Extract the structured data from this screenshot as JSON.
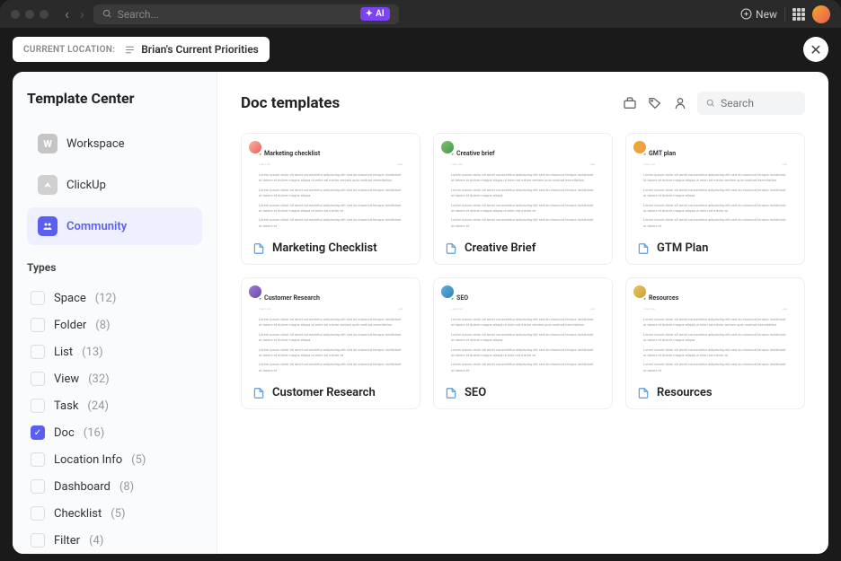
{
  "topbar": {
    "search_placeholder": "Search...",
    "ai_label": "AI",
    "new_label": "New"
  },
  "location": {
    "label": "CURRENT LOCATION:",
    "value": "Brian's Current Priorities"
  },
  "sidebar": {
    "title": "Template Center",
    "sources": [
      {
        "label": "Workspace",
        "icon": "W"
      },
      {
        "label": "ClickUp",
        "icon": ""
      },
      {
        "label": "Community",
        "icon": ""
      }
    ],
    "types_header": "Types",
    "types": [
      {
        "label": "Space",
        "count": "(12)",
        "checked": false
      },
      {
        "label": "Folder",
        "count": "(8)",
        "checked": false
      },
      {
        "label": "List",
        "count": "(13)",
        "checked": false
      },
      {
        "label": "View",
        "count": "(32)",
        "checked": false
      },
      {
        "label": "Task",
        "count": "(24)",
        "checked": false
      },
      {
        "label": "Doc",
        "count": "(16)",
        "checked": true
      },
      {
        "label": "Location Info",
        "count": "(5)",
        "checked": false
      },
      {
        "label": "Dashboard",
        "count": "(8)",
        "checked": false
      },
      {
        "label": "Checklist",
        "count": "(5)",
        "checked": false
      },
      {
        "label": "Filter",
        "count": "(4)",
        "checked": false
      }
    ]
  },
  "main": {
    "title": "Doc templates",
    "search_placeholder": "Search",
    "cards": [
      {
        "title": "Marketing Checklist",
        "preview_title": "Marketing checklist"
      },
      {
        "title": "Creative Brief",
        "preview_title": "Creative brief"
      },
      {
        "title": "GTM Plan",
        "preview_title": "GMT plan"
      },
      {
        "title": "Customer Research",
        "preview_title": "Customer Research"
      },
      {
        "title": "SEO",
        "preview_title": "SEO"
      },
      {
        "title": "Resources",
        "preview_title": "Resources"
      }
    ]
  }
}
